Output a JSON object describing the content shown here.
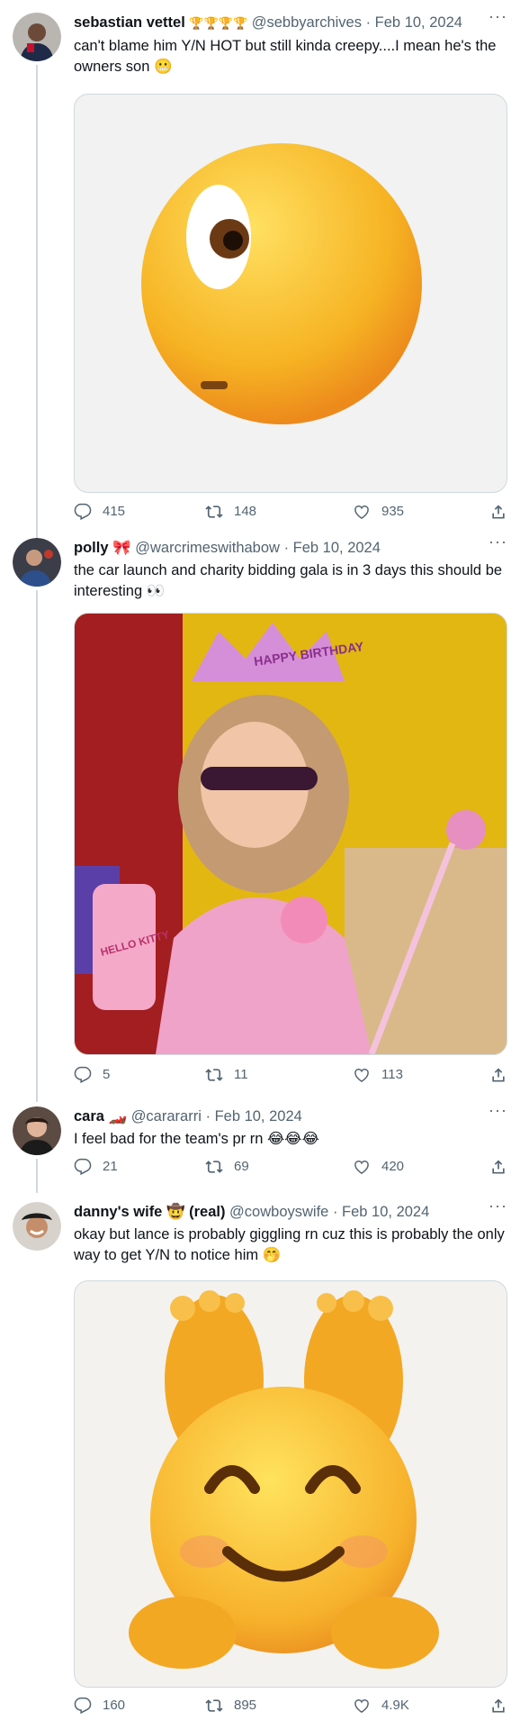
{
  "tweets": [
    {
      "name": "sebastian vettel",
      "name_suffix": "🏆🏆🏆🏆",
      "handle": "@sebbyarchives",
      "date": "Feb 10, 2024",
      "text": "can't blame him Y/N HOT but still kinda creepy....I mean he's the owners son 😬",
      "replies": "415",
      "retweets": "148",
      "likes": "935"
    },
    {
      "name": "polly",
      "name_suffix": "🎀",
      "handle": "@warcrimeswithabow",
      "date": "Feb 10, 2024",
      "text": "the car launch and charity bidding gala is in 3 days this should be interesting 👀",
      "media_text": [
        "HAPPY BIRTHDAY",
        "HELLO KITTY"
      ],
      "replies": "5",
      "retweets": "11",
      "likes": "113"
    },
    {
      "name": "cara",
      "name_suffix": "🏎️",
      "handle": "@carararri",
      "date": "Feb 10, 2024",
      "text": "I feel bad for the team's pr rn 😂😂😂",
      "replies": "21",
      "retweets": "69",
      "likes": "420"
    },
    {
      "name": "danny's wife",
      "name_suffix": "🤠 (real)",
      "handle": "@cowboyswife",
      "date": "Feb 10, 2024",
      "text": "okay but lance is probably giggling rn cuz this is probably the only way to get Y/N to notice him 🤭",
      "replies": "160",
      "retweets": "895",
      "likes": "4.9K"
    }
  ],
  "more_glyph": "···",
  "separator": "·",
  "colors": {
    "text": "#0f1419",
    "muted": "#536471",
    "border": "#cfd9de",
    "emoji": "#f5b524"
  }
}
